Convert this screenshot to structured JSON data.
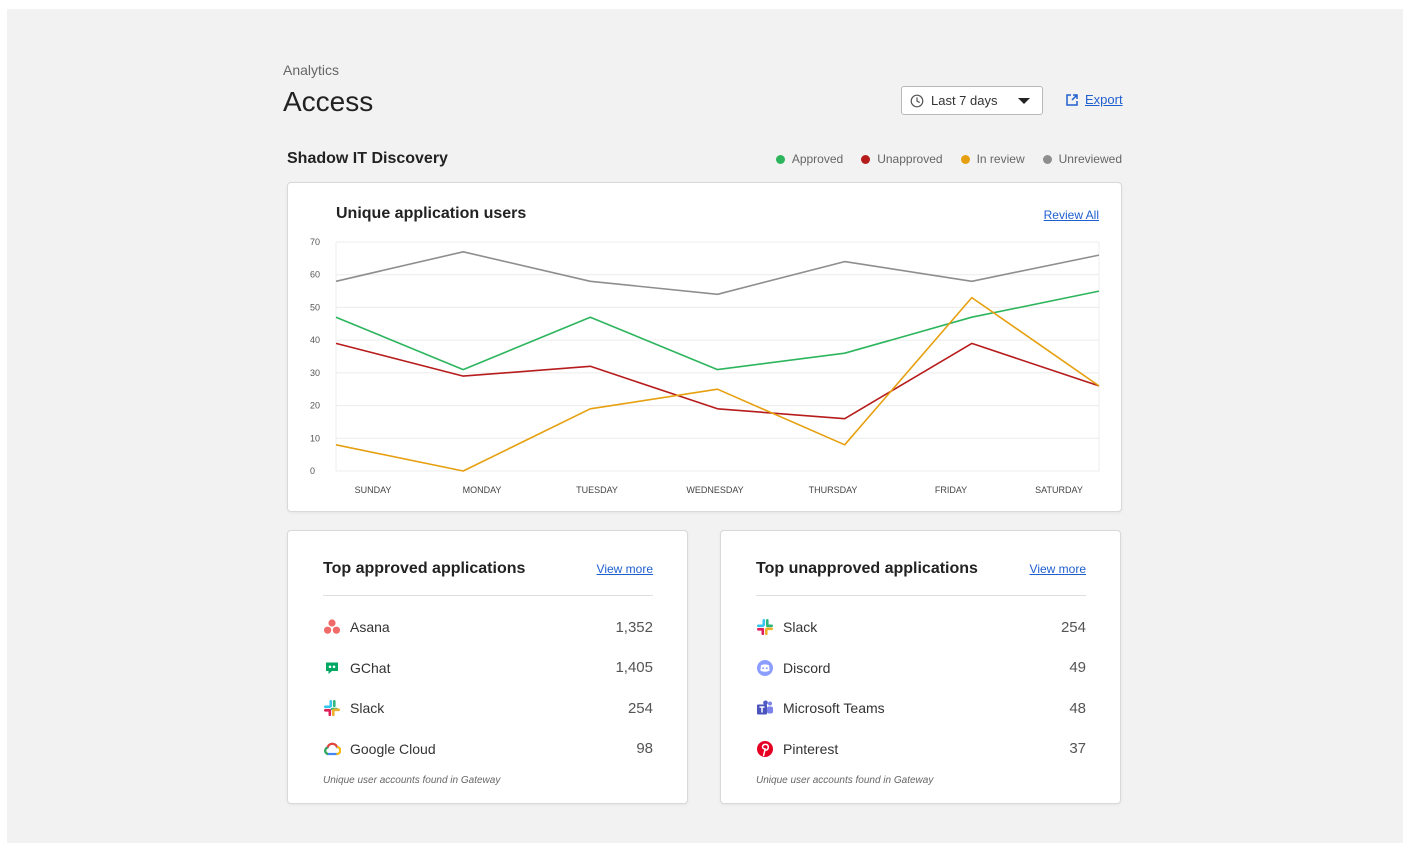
{
  "header": {
    "breadcrumb": "Analytics",
    "title": "Access",
    "date_range": "Last 7 days",
    "export_label": "Export"
  },
  "section": {
    "title": "Shadow IT Discovery",
    "legend": [
      {
        "label": "Approved",
        "color": "#2db55d"
      },
      {
        "label": "Unapproved",
        "color": "#b71c1c"
      },
      {
        "label": "In review",
        "color": "#e6a00f"
      },
      {
        "label": "Unreviewed",
        "color": "#8e8e8e"
      }
    ]
  },
  "chart_card": {
    "title": "Unique application users",
    "review_all_label": "Review All"
  },
  "chart_data": {
    "type": "line",
    "categories": [
      "SUNDAY",
      "MONDAY",
      "TUESDAY",
      "WEDNESDAY",
      "THURSDAY",
      "FRIDAY",
      "SATURDAY"
    ],
    "ylim": [
      0,
      70
    ],
    "yticks": [
      0,
      10,
      20,
      30,
      40,
      50,
      60,
      70
    ],
    "grid": true,
    "series": [
      {
        "name": "Unreviewed",
        "color": "#8e8e8e",
        "values": [
          58,
          67,
          58,
          54,
          64,
          58,
          66
        ]
      },
      {
        "name": "Approved",
        "color": "#2db55d",
        "values": [
          47,
          31,
          47,
          31,
          36,
          47,
          55
        ]
      },
      {
        "name": "Unapproved",
        "color": "#b71c1c",
        "values": [
          39,
          29,
          32,
          19,
          16,
          39,
          26
        ]
      },
      {
        "name": "In review",
        "color": "#e6a00f",
        "values": [
          8,
          0,
          19,
          25,
          8,
          53,
          26
        ]
      }
    ]
  },
  "approved": {
    "title": "Top approved applications",
    "view_more": "View more",
    "footnote": "Unique user accounts found in Gateway",
    "items": [
      {
        "name": "Asana",
        "count": "1,352",
        "icon": "asana-icon"
      },
      {
        "name": "GChat",
        "count": "1,405",
        "icon": "gchat-icon"
      },
      {
        "name": "Slack",
        "count": "254",
        "icon": "slack-icon"
      },
      {
        "name": "Google Cloud",
        "count": "98",
        "icon": "google-cloud-icon"
      }
    ]
  },
  "unapproved": {
    "title": "Top unapproved applications",
    "view_more": "View more",
    "footnote": "Unique user accounts found in Gateway",
    "items": [
      {
        "name": "Slack",
        "count": "254",
        "icon": "slack-icon"
      },
      {
        "name": "Discord",
        "count": "49",
        "icon": "discord-icon"
      },
      {
        "name": "Microsoft Teams",
        "count": "48",
        "icon": "microsoft-teams-icon"
      },
      {
        "name": "Pinterest",
        "count": "37",
        "icon": "pinterest-icon"
      }
    ]
  }
}
